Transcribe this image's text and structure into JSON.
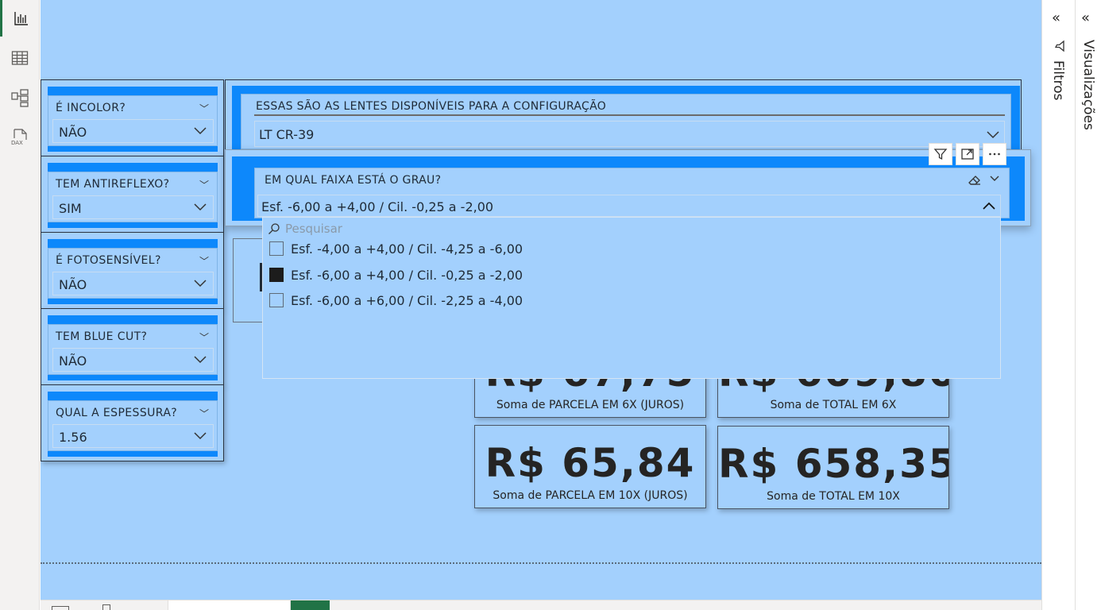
{
  "left_rail": {
    "items": [
      {
        "icon": "report-view-icon",
        "active": true
      },
      {
        "icon": "table-view-icon",
        "active": false
      },
      {
        "icon": "model-view-icon",
        "active": false
      },
      {
        "icon": "dax-query-icon",
        "active": false
      }
    ]
  },
  "slicers": [
    {
      "title": "É INCOLOR?",
      "value": "NÃO"
    },
    {
      "title": "TEM ANTIREFLEXO?",
      "value": "SIM"
    },
    {
      "title": "É FOTOSENSÍVEL?",
      "value": "NÃO"
    },
    {
      "title": "TEM BLUE CUT?",
      "value": "NÃO"
    },
    {
      "title": "QUAL A ESPESSURA?",
      "value": "1.56"
    }
  ],
  "lens_slicer": {
    "title": "ESSAS SÃO AS LENTES DISPONÍVEIS PARA A CONFIGURAÇÃO",
    "value": "LT CR-39"
  },
  "grade_slicer": {
    "title": "EM QUAL FAIXA ESTÁ O GRAU?",
    "value": "Esf. -6,00 a +4,00 / Cil. -0,25 a -2,00"
  },
  "dropdown": {
    "search_placeholder": "Pesquisar",
    "options": [
      {
        "label": "Esf. -4,00 a +4,00 / Cil. -4,25 a -6,00",
        "checked": false
      },
      {
        "label": "Esf. -6,00 a +4,00 / Cil. -0,25 a -2,00",
        "checked": true
      },
      {
        "label": "Esf. -6,00 a +6,00 / Cil. -2,25 a -4,00",
        "checked": false
      }
    ]
  },
  "cards": {
    "parcela_6x": {
      "value": "R$ 67,75",
      "label": "Soma de PARCELA EM 6X (JUROS)"
    },
    "total_6x": {
      "value": "R$ 609,80",
      "label": "Soma de TOTAL EM 6X"
    },
    "parcela_10x": {
      "value": "R$ 65,84",
      "label": "Soma de PARCELA EM 10X (JUROS)"
    },
    "total_10x": {
      "value": "R$ 658,35",
      "label": "Soma de TOTAL EM 10X"
    }
  },
  "right_panes": {
    "filters_label": "Filtros",
    "visualizations_label": "Visualizações"
  },
  "colors": {
    "canvas_bg": "#a3d0fd",
    "slicer_header": "#0d88fb",
    "active_accent": "#217346"
  }
}
